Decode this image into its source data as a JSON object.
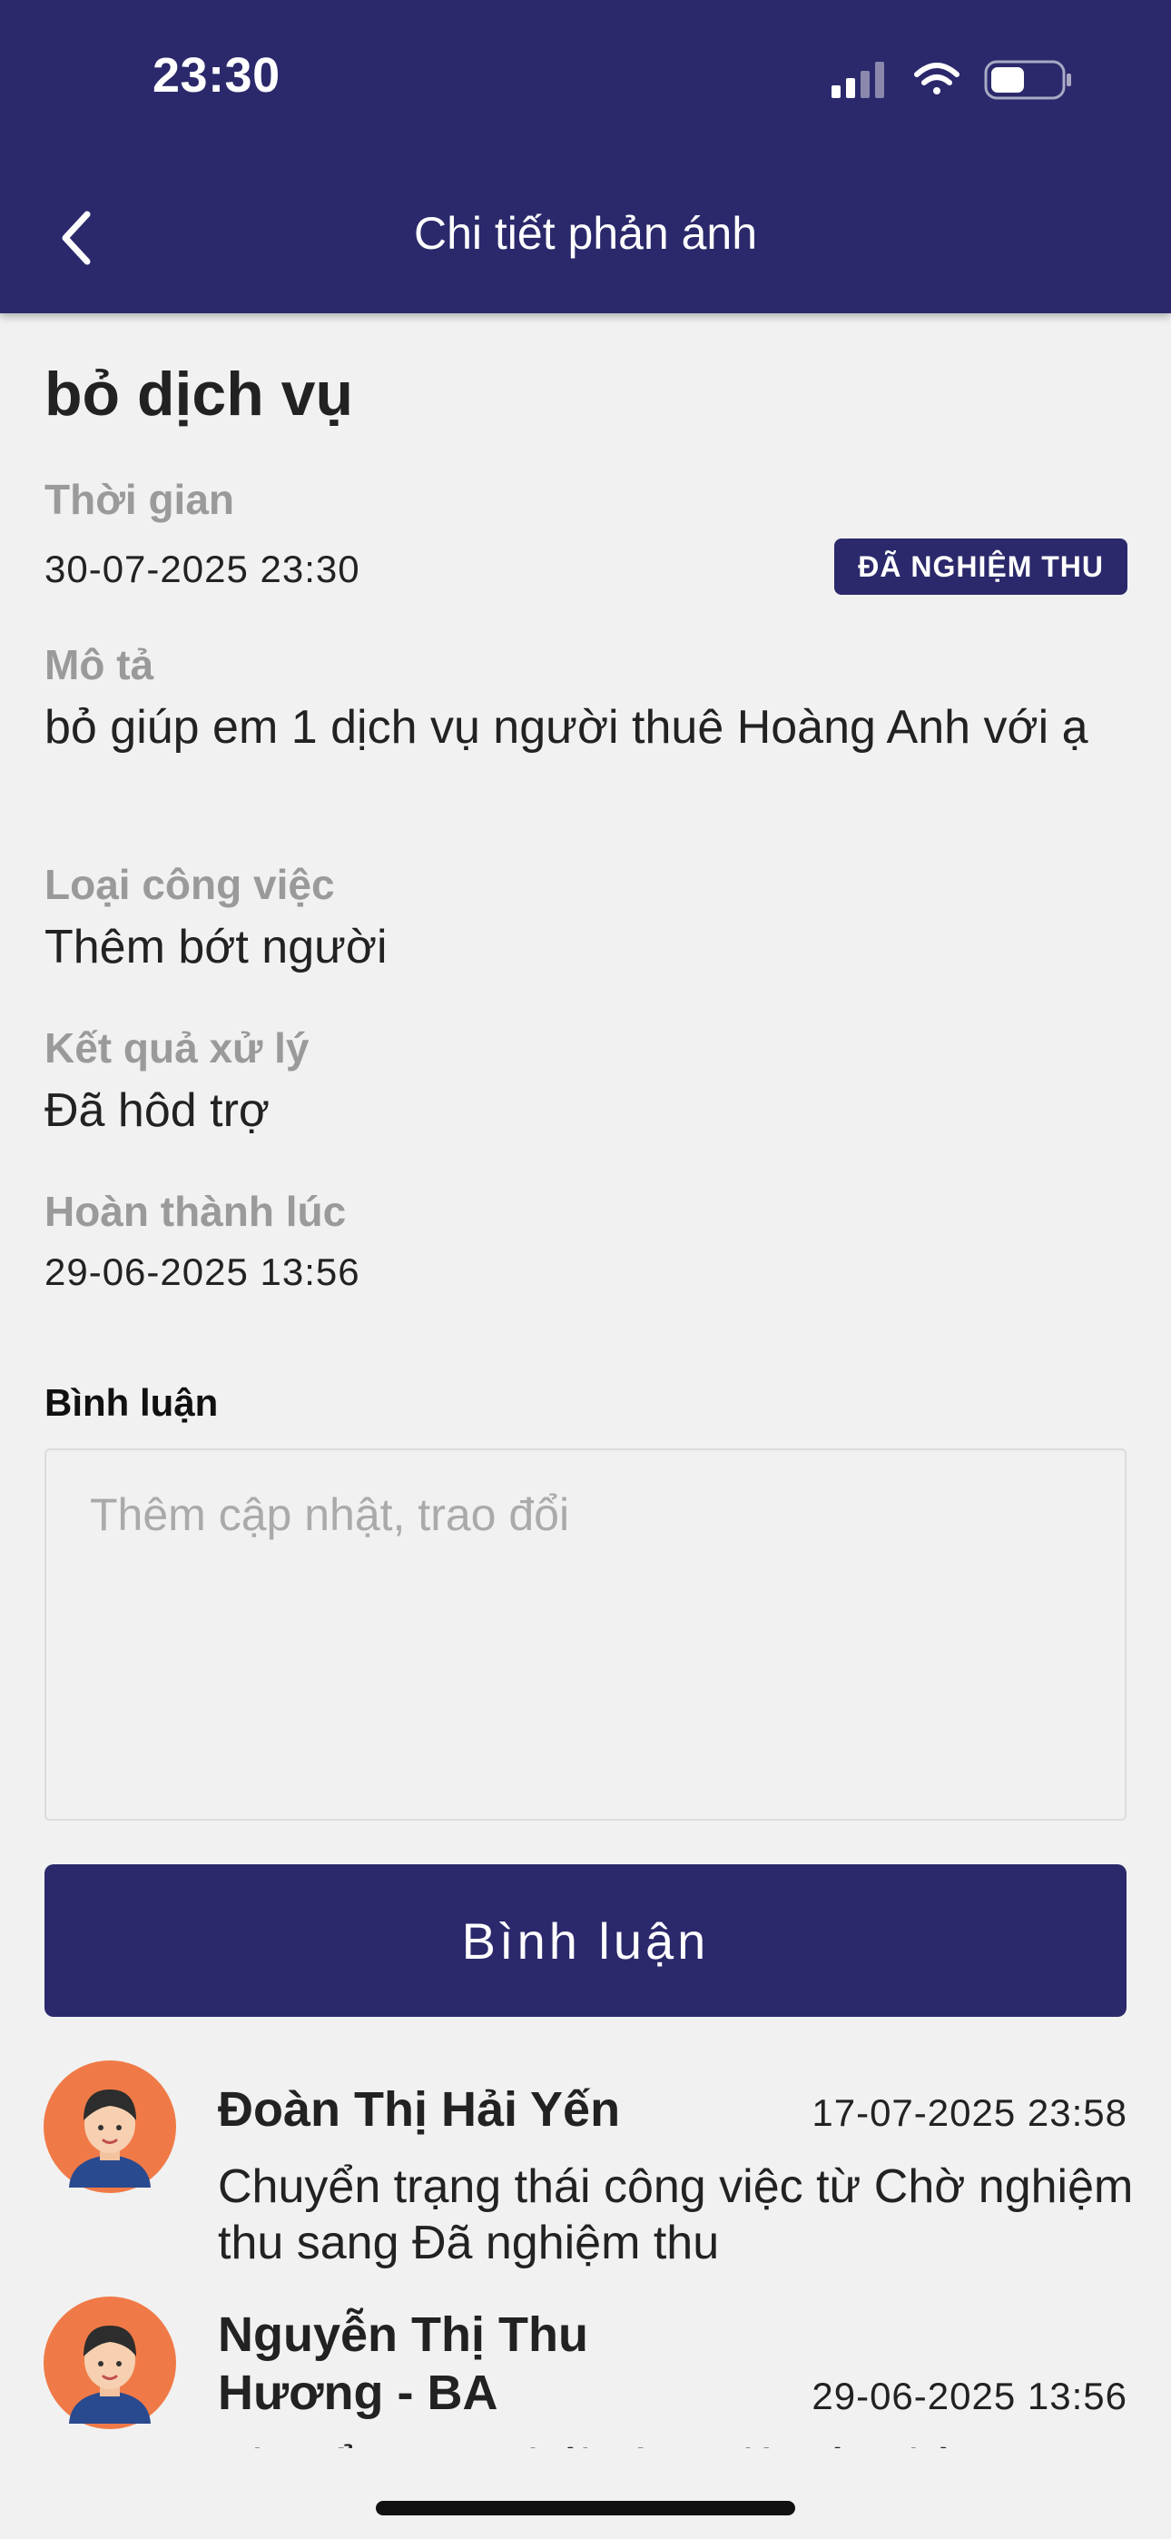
{
  "status_bar": {
    "time": "23:30",
    "icons": [
      "signal-icon",
      "wifi-icon",
      "battery-icon"
    ]
  },
  "nav": {
    "back_icon": "chevron-left-icon",
    "title": "Chi tiết phản ánh"
  },
  "detail": {
    "heading": "bỏ dịch vụ",
    "time_label": "Thời gian",
    "time_value": "30-07-2025 23:30",
    "status_badge": "ĐÃ NGHIỆM THU",
    "description_label": "Mô tả",
    "description_value": "bỏ giúp em 1 dịch vụ người thuê Hoàng Anh với ạ",
    "job_type_label": "Loại công việc",
    "job_type_value": "Thêm bớt người",
    "result_label": "Kết quả xử lý",
    "result_value": "Đã hôd trợ",
    "completed_label": "Hoàn thành lúc",
    "completed_value": "29-06-2025 13:56"
  },
  "comments": {
    "label": "Bình luận",
    "input_placeholder": "Thêm cập nhật, trao đổi",
    "submit_label": "Bình luận",
    "items": [
      {
        "author": "Đoàn Thị Hải Yến",
        "date": "17-07-2025 23:58",
        "text": "Chuyển trạng thái công việc từ Chờ nghiệm thu sang Đã nghiệm thu",
        "avatar_icon": "user-avatar-icon"
      },
      {
        "author": "Nguyễn Thị Thu Hương - BA",
        "date": "29-06-2025 13:56",
        "text": "Chuyển trạng thái công việc từ Chờ",
        "avatar_icon": "user-avatar-icon"
      }
    ]
  },
  "colors": {
    "primary": "#2b296b",
    "background": "#f1f1f1",
    "label_gray": "#9a9a9a",
    "avatar_bg": "#f07a47"
  }
}
